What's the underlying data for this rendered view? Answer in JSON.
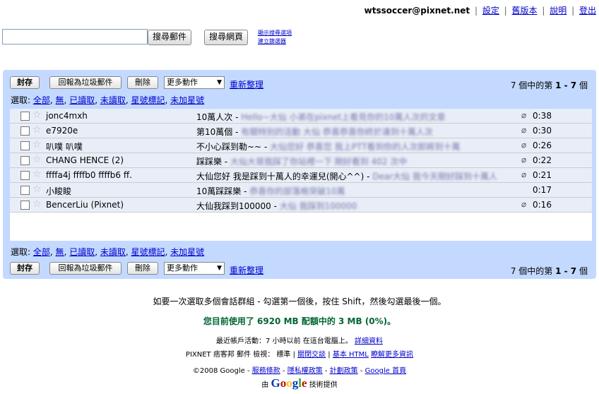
{
  "header": {
    "account": "wtssoccer@pixnet.net",
    "links": [
      "設定",
      "舊版本",
      "說明",
      "登出"
    ]
  },
  "search": {
    "query": "",
    "mail_button": "搜尋郵件",
    "web_button": "搜尋網頁",
    "show_options": "顯示搜尋選項",
    "create_filter": "建立篩選器"
  },
  "toolbar": {
    "archive": "封存",
    "spam": "回報為垃圾郵件",
    "delete": "刪除",
    "more_actions": "更多動作",
    "refresh": "重新整理",
    "count_prefix": "7 個中的第 ",
    "count_range": "1 - 7",
    "count_suffix": " 個"
  },
  "select": {
    "label": "選取:",
    "options": [
      "全部",
      "無",
      "已讀取",
      "未讀取",
      "星號標記",
      "未加星號"
    ]
  },
  "emails": [
    {
      "sender": "jonc4mxh",
      "subject": "10萬人次",
      "snippet": "Hello~大仙 小弟在pixnet上看見你的10萬人次的文章",
      "attach": true,
      "time": "0:38"
    },
    {
      "sender": "e7920e",
      "subject": "第10萬個",
      "snippet": "有關特別的活動 大仙 恭喜恭喜你終於達到十萬人次",
      "attach": true,
      "time": "0:30"
    },
    {
      "sender": "叭噗 叭噗",
      "subject": "不小心踩到勒~~",
      "snippet": "大仙您好 恭喜您 我上PTT看到你的人次即將到十萬",
      "attach": true,
      "time": "0:26"
    },
    {
      "sender": "CHANG HENCE (2)",
      "subject": "踩踩樂",
      "snippet": "大仙大哥我踩了你站裡一下 剛好看到 402 次中",
      "attach": true,
      "time": "0:22"
    },
    {
      "sender": "ffffa4j ffffb0 ffffb6 ff.",
      "subject": "大仙您好 我是踩到十萬人的幸運兒(開心^^)",
      "snippet": "Dear大仙 我今天剛好踩到十萬人",
      "attach": true,
      "time": "0:21"
    },
    {
      "sender": "小睃睃",
      "subject": "10萬踩踩樂",
      "snippet": "恭喜你的部落格突破10萬",
      "attach": false,
      "time": "0:17"
    },
    {
      "sender": "BencerLiu (Pixnet)",
      "subject": "大仙我踩到100000",
      "snippet": "大仙 我踩到100000",
      "attach": true,
      "time": "0:16"
    }
  ],
  "footer": {
    "tip": "如要一次選取多個會話群組 - 勾選第一個後，按住 Shift，然後勾選最後一個。",
    "quota": "您目前使用了 6920 MB 配額中的 3 MB (0%)。",
    "activity": "最近帳戶活動：7 小時以前 在這台電腦上。",
    "details": "詳細資料",
    "view_prefix": "PIXNET 痞客邦 郵件 檢視：",
    "view_standard": "標準",
    "view_chat_off": "關閉交談",
    "view_basic": "基本 HTML",
    "view_learn": "瞭解更多資訊",
    "copyright": "©2008 Google - ",
    "terms": "服務條款",
    "privacy": "隱私權政策",
    "program": "計劃政策",
    "google_home": "Google 首頁",
    "powered_prefix": "由",
    "google": "Google",
    "powered_suffix": "技術提供"
  }
}
